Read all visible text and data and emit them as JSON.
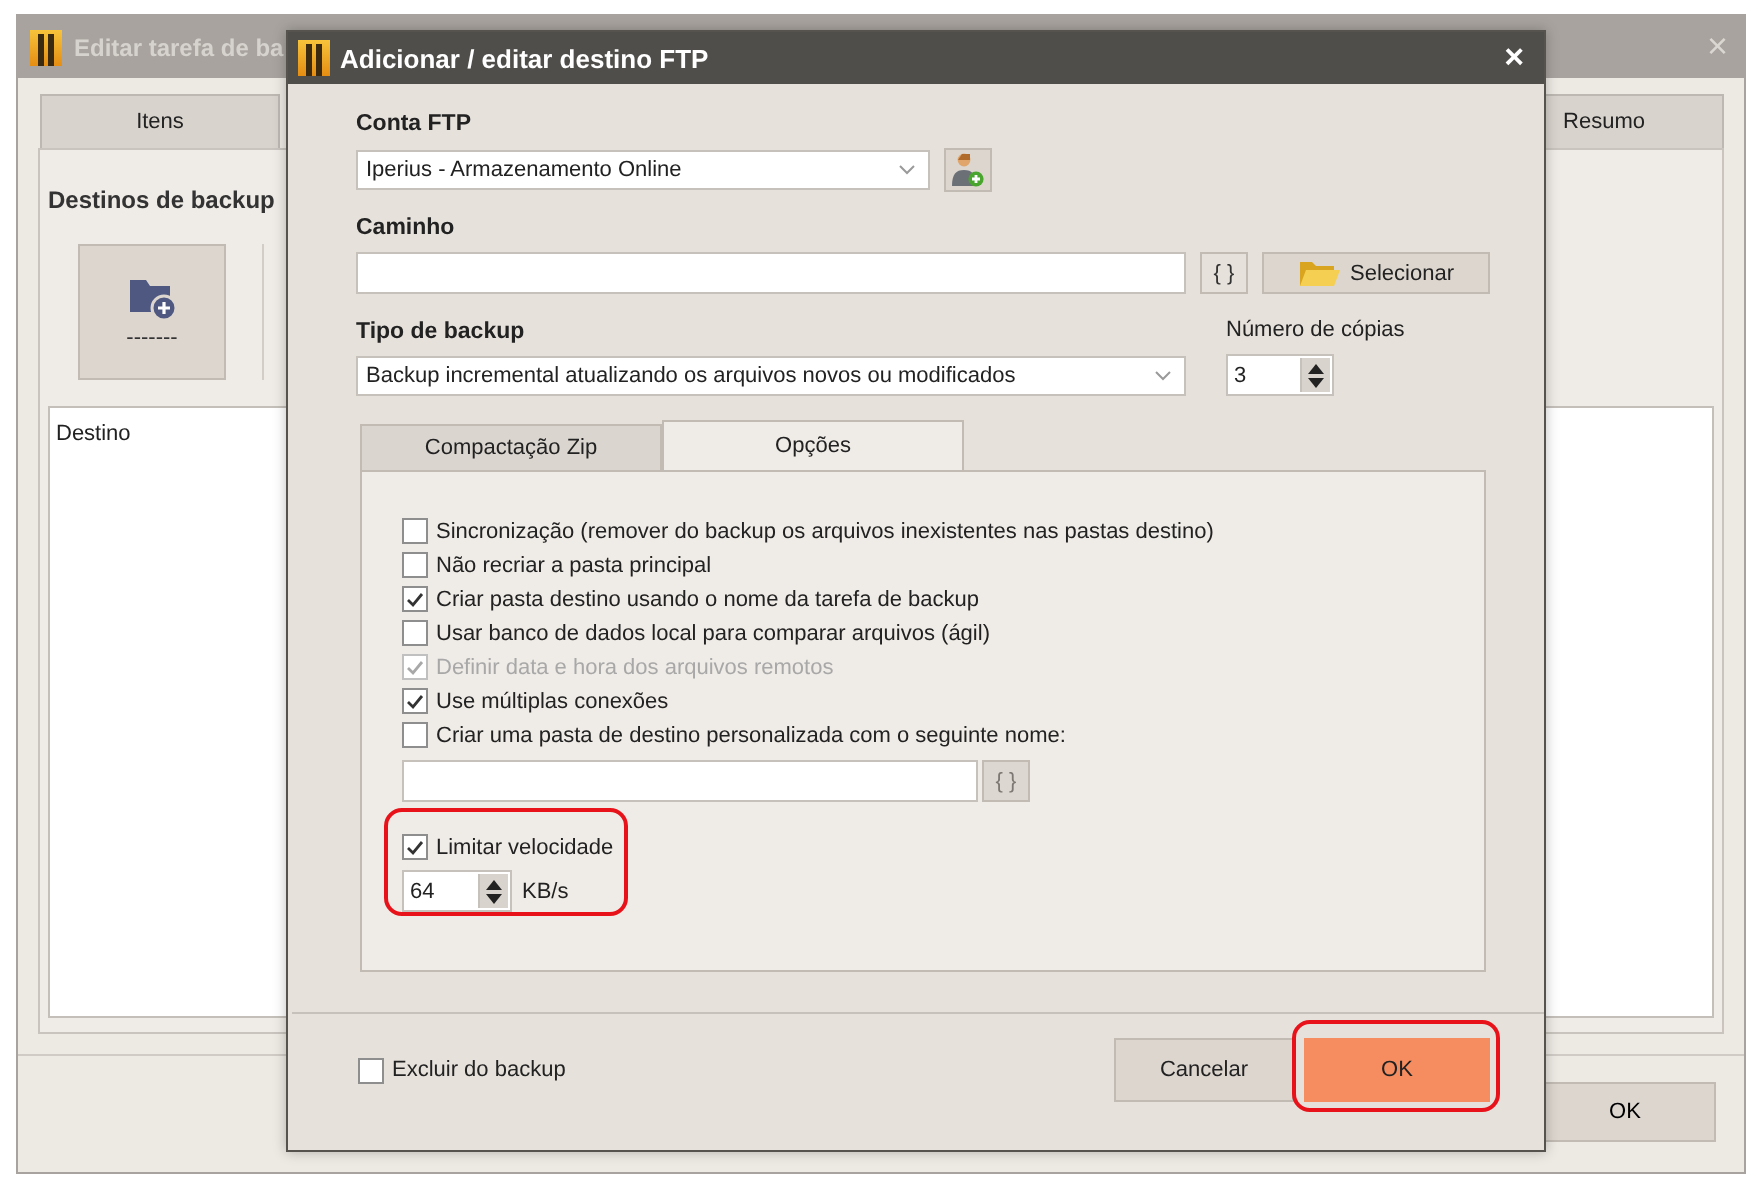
{
  "back_window": {
    "title": "Editar tarefa de ba",
    "close": "×",
    "tabs": [
      {
        "label": "Itens",
        "selected": false
      },
      {
        "label": "Resumo",
        "selected": false
      }
    ],
    "heading": "Destinos de backup",
    "add_tile_label": "-------",
    "list_header": "Destino",
    "ok_button": "OK"
  },
  "dialog": {
    "title": "Adicionar / editar destino FTP",
    "close": "×",
    "account_label": "Conta FTP",
    "account_value": "Iperius - Armazenamento Online",
    "path_label": "Caminho",
    "variables_button": "{ }",
    "select_button": "Selecionar",
    "backup_type_label": "Tipo de backup",
    "backup_type_value": "Backup incremental atualizando os arquivos novos ou modificados",
    "copies_label": "Número de cópias",
    "copies_value": "3",
    "tabs": [
      {
        "label": "Compactação Zip",
        "selected": false
      },
      {
        "label": "Opções",
        "selected": true
      }
    ],
    "options": [
      {
        "label": "Sincronização (remover do backup os arquivos inexistentes nas pastas destino)",
        "checked": false,
        "disabled": false
      },
      {
        "label": "Não recriar a pasta principal",
        "checked": false,
        "disabled": false
      },
      {
        "label": "Criar pasta destino usando o nome da tarefa de backup",
        "checked": true,
        "disabled": false
      },
      {
        "label": "Usar banco de dados local para comparar arquivos (ágil)",
        "checked": false,
        "disabled": false
      },
      {
        "label": "Definir data e hora dos arquivos remotos",
        "checked": true,
        "disabled": true
      },
      {
        "label": "Use múltiplas conexões",
        "checked": true,
        "disabled": false
      },
      {
        "label": "Criar uma pasta de destino personalizada com o seguinte nome:",
        "checked": false,
        "disabled": false
      }
    ],
    "custom_folder_button": {
      "label": "{ }",
      "disabled": true
    },
    "speed_limit": {
      "label": "Limitar velocidade",
      "checked": true,
      "value": "64",
      "unit": "KB/s",
      "highlighted": true
    },
    "exclude": {
      "label": "Excluir do backup",
      "checked": false
    },
    "buttons": [
      {
        "label": "Cancelar",
        "kind": "normal",
        "highlighted": false
      },
      {
        "label": "OK",
        "kind": "primary",
        "highlighted": true
      }
    ]
  }
}
